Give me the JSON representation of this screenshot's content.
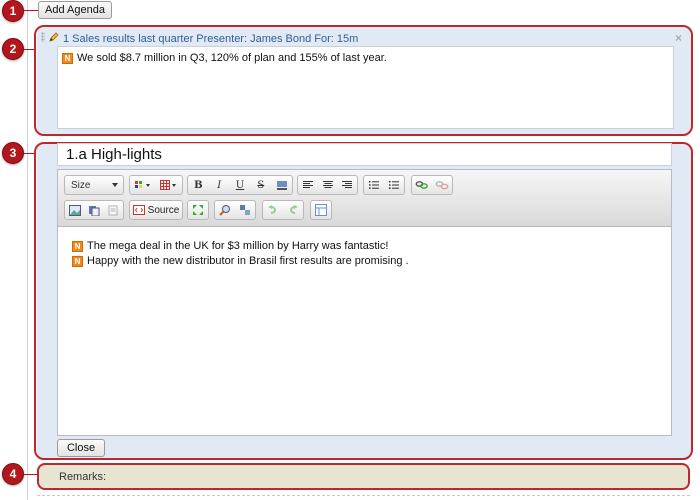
{
  "add_agenda_label": "Add Agenda",
  "markers": [
    "1",
    "2",
    "3",
    "4"
  ],
  "item1": {
    "title": "1 Sales results last quarter Presenter: James Bond For: 15m",
    "close_glyph": "×",
    "notes": [
      {
        "badge": "N",
        "text": "We sold $8.7 million in Q3, 120% of plan and 155% of last year."
      }
    ]
  },
  "item2": {
    "title": "1.a High-lights",
    "toolbar": {
      "size_label": "Size",
      "source_label": "Source"
    },
    "notes": [
      {
        "badge": "N",
        "text": "The mega deal in the UK for $3 million by Harry was fantastic!"
      },
      {
        "badge": "N",
        "text": "Happy with the new distributor in Brasil first results are promising ."
      }
    ],
    "close_label": "Close"
  },
  "remarks_label": "Remarks:",
  "colors": {
    "accent_red": "#c0272d",
    "panel_blue": "#e1eaf4",
    "title_blue": "#2d5f9a",
    "note_orange": "#f08a1c",
    "remarks_bg": "#e8e4d2"
  }
}
